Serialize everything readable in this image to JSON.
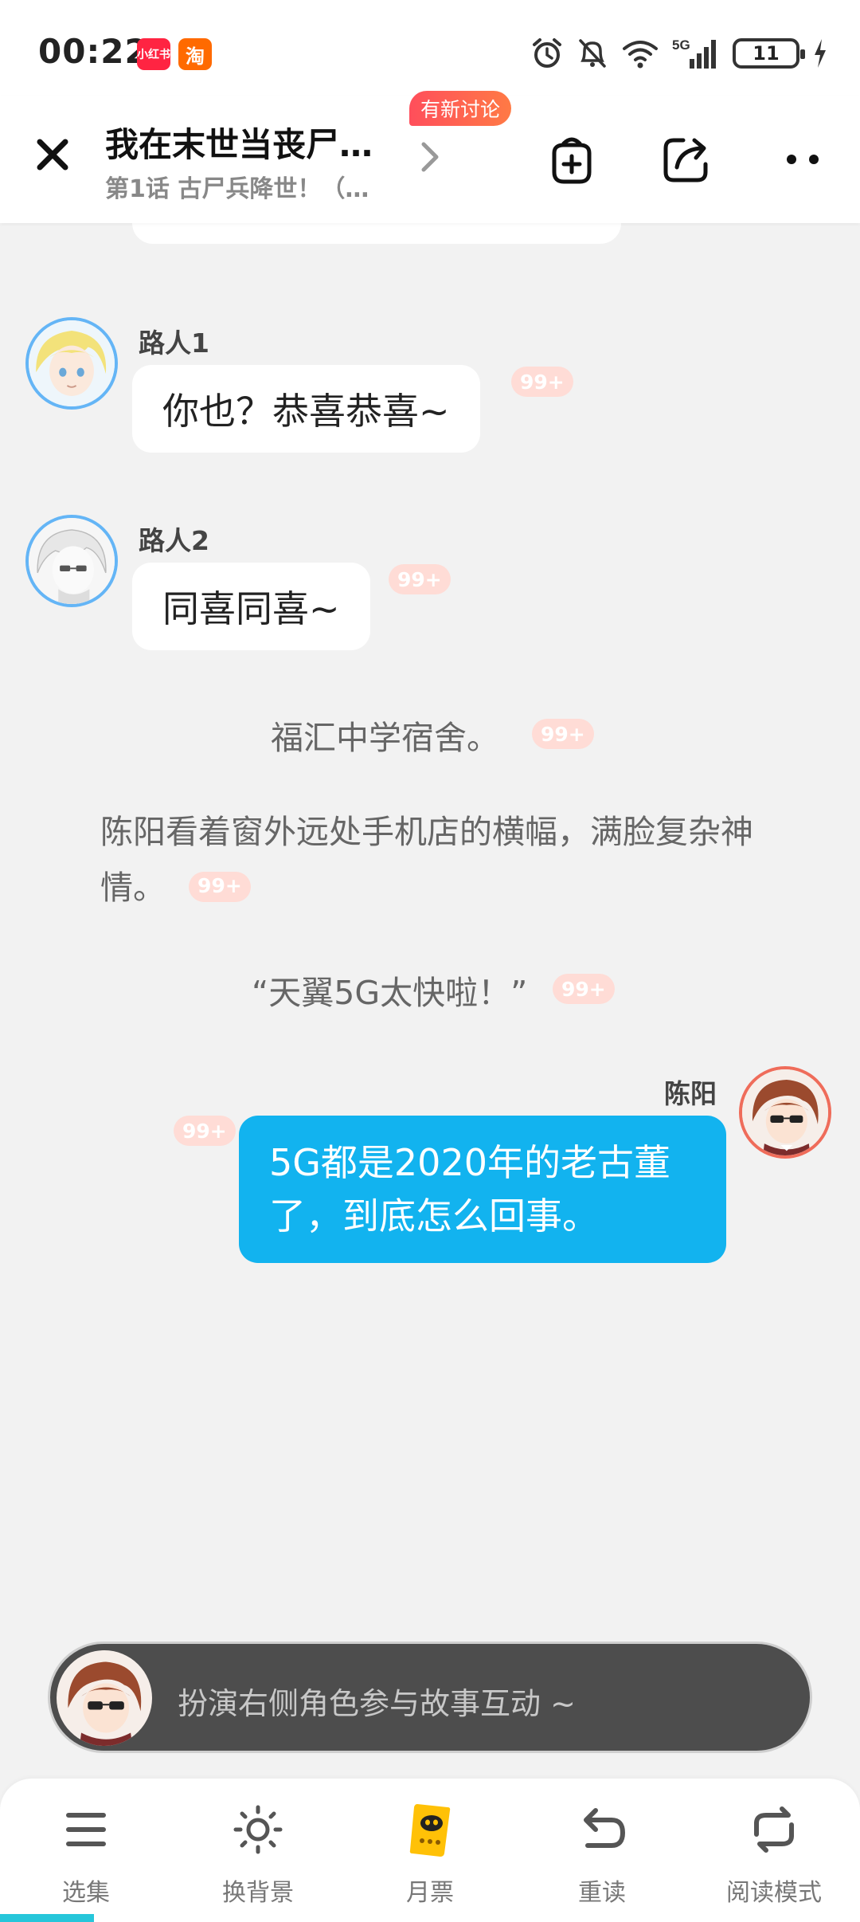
{
  "status_bar": {
    "time": "00:22",
    "app_badges": [
      {
        "name": "xiaohongshu",
        "label": "小红书",
        "color": "#ff2442"
      },
      {
        "name": "taobao",
        "label": "淘",
        "color": "#ff6a00"
      }
    ],
    "network": "5G",
    "battery_level": "11",
    "icons": [
      "alarm-icon",
      "mute-bell-icon",
      "wifi-icon",
      "signal-icon",
      "battery-icon",
      "charging-icon"
    ]
  },
  "header": {
    "title": "我在末世当丧尸…",
    "subtitle": "第1话 古尸兵降世！（…",
    "new_discussion_badge": "有新讨论",
    "icons": [
      "close-icon",
      "chevron-right-icon",
      "add-bag-icon",
      "share-icon",
      "more-icon"
    ]
  },
  "chat": {
    "top_bubble_partial": "",
    "messages": [
      {
        "speaker": "路人1",
        "text": "你也？恭喜恭喜~",
        "count": "99+",
        "side": "left",
        "avatar": "blonde-avatar"
      },
      {
        "speaker": "路人2",
        "text": "同喜同喜~",
        "count": "99+",
        "side": "left",
        "avatar": "white-hair-avatar"
      }
    ],
    "narrations": [
      {
        "text": "福汇中学宿舍。",
        "count": "99+"
      },
      {
        "text": "陈阳看着窗外远处手机店的横幅，满脸复杂神情。",
        "count": "99+"
      },
      {
        "text": "“天翼5G太快啦！”",
        "count": "99+"
      }
    ],
    "self_message": {
      "speaker": "陈阳",
      "text": "5G都是2020年的老古董了，到底怎么回事。",
      "count": "99+",
      "side": "right"
    }
  },
  "roleplay": {
    "placeholder": "扮演右侧角色参与故事互动 ~"
  },
  "bottom_nav": {
    "items": [
      {
        "label": "选集",
        "icon": "list-icon"
      },
      {
        "label": "换背景",
        "icon": "sun-icon"
      },
      {
        "label": "月票",
        "icon": "monthly-ticket-icon"
      },
      {
        "label": "重读",
        "icon": "reread-icon"
      },
      {
        "label": "阅读模式",
        "icon": "read-mode-icon"
      }
    ]
  },
  "colors": {
    "accent_blue": "#12b3ef",
    "badge_red": "#ff4e5b",
    "count_pink": "#ffdcd6",
    "background": "#f2f2f2"
  }
}
